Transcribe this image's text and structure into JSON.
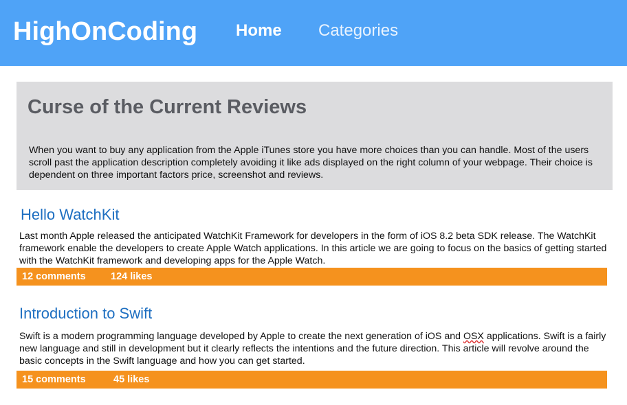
{
  "header": {
    "brand": "HighOnCoding",
    "nav": [
      {
        "label": "Home",
        "active": true
      },
      {
        "label": "Categories",
        "active": false
      }
    ],
    "background_color": "#4fa3f7"
  },
  "hero": {
    "title": "Curse of the Current Reviews",
    "text": "When you want to buy any application from the Apple iTunes store you have more choices than you can handle. Most of the users scroll past the application description completely avoiding it like ads displayed on the right column of your webpage. Their choice is dependent on three important factors price, screenshot and reviews."
  },
  "articles": [
    {
      "title": "Hello WatchKit",
      "body": "Last month Apple released the anticipated WatchKit Framework for developers in the form of iOS 8.2 beta SDK release. The WatchKit framework enable the developers to create Apple Watch applications. In this article we are going to focus on the basics of getting started with the WatchKit framework and developing apps for the Apple Watch.",
      "comments": "12 comments",
      "likes": "124 likes"
    },
    {
      "title": "Introduction to Swift",
      "body_before": "Swift is a modern programming language developed by Apple to create the next generation of iOS and ",
      "body_flagged": "OSX",
      "body_after": " applications. Swift is a fairly new language and still in development but it clearly reflects the intentions and the future direction. This article will revolve around the basic concepts in the Swift language and how you can get started.",
      "comments": "15 comments",
      "likes": "45 likes"
    }
  ],
  "colors": {
    "accent_bar": "#f5921e",
    "link": "#1e6fc1",
    "hero_bg": "#dcdcde"
  }
}
